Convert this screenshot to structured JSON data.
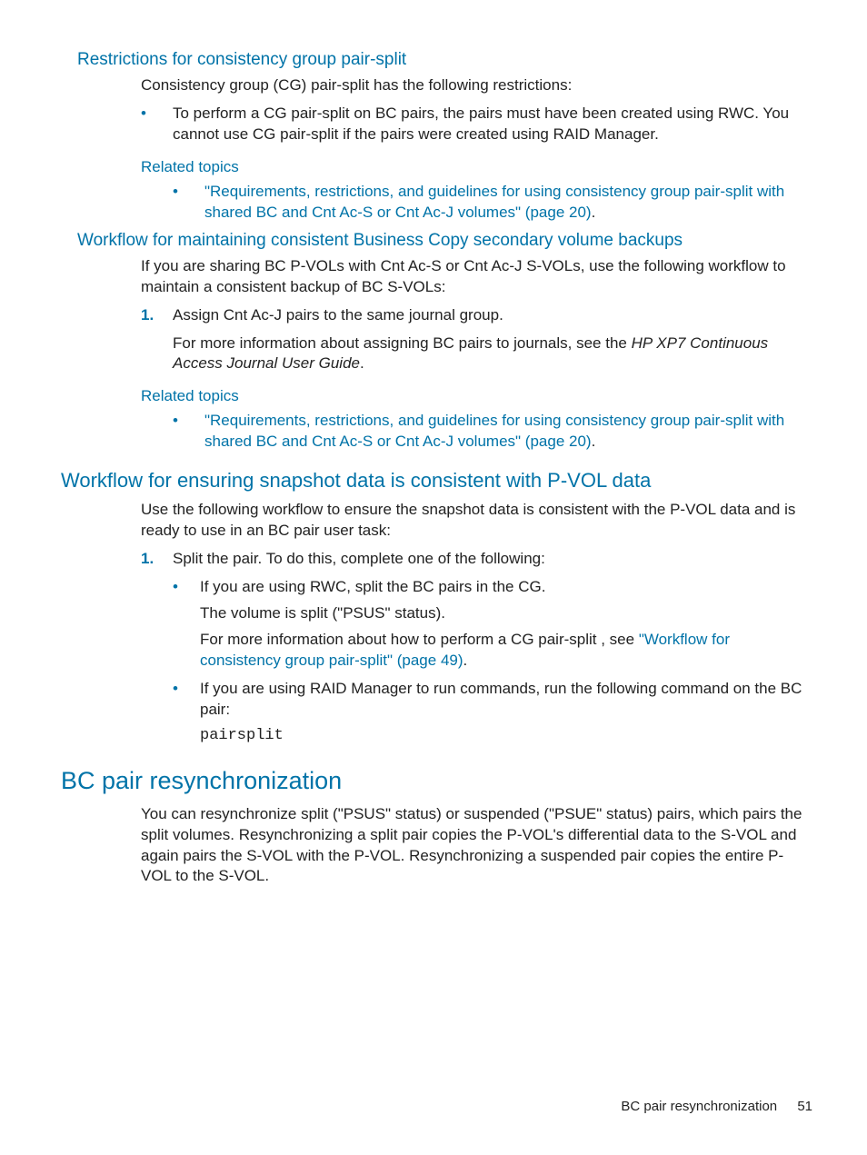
{
  "sec1": {
    "heading": "Restrictions for consistency group pair-split",
    "intro": "Consistency group (CG) pair-split has the following restrictions:",
    "bullet1": "To perform a CG pair-split on BC pairs, the pairs must have been created using RWC. You cannot use CG pair-split if the pairs were created using RAID Manager.",
    "related_heading": "Related topics",
    "related_link": "\"Requirements, restrictions, and guidelines for using consistency group pair-split with shared BC and Cnt Ac-S or Cnt Ac-J volumes\" (page 20)",
    "related_dot": "."
  },
  "sec2": {
    "heading": "Workflow for maintaining consistent Business Copy secondary volume backups",
    "intro": "If you are sharing BC P-VOLs with Cnt Ac-S or Cnt Ac-J S-VOLs, use the following workflow to maintain a consistent backup of BC S-VOLs:",
    "step1": "Assign Cnt Ac-J pairs to the same journal group.",
    "more_info_pre": "For more information about assigning BC pairs to journals, see the ",
    "more_info_italic": "HP XP7 Continuous Access Journal User Guide",
    "more_info_post": ".",
    "related_heading": "Related topics",
    "related_link": "\"Requirements, restrictions, and guidelines for using consistency group pair-split with shared BC and Cnt Ac-S or Cnt Ac-J volumes\" (page 20)",
    "related_dot": "."
  },
  "sec3": {
    "heading": "Workflow for ensuring snapshot data is consistent with P-VOL data",
    "intro": "Use the following workflow to ensure the snapshot data is consistent with the P-VOL data and is ready to use in an BC pair user task:",
    "step1": "Split the pair. To do this, complete one of the following:",
    "sub1_line1": "If you are using RWC, split the BC pairs in the CG.",
    "sub1_line2": "The volume is split (\"PSUS\" status).",
    "sub1_line3_pre": "For more information about how to perform a CG pair-split , see ",
    "sub1_line3_link": "\"Workflow for consistency group pair-split\" (page 49)",
    "sub1_line3_post": ".",
    "sub2_line1": "If you are using RAID Manager to run commands, run the following command on the BC pair:",
    "sub2_code": "pairsplit"
  },
  "sec4": {
    "heading": "BC pair resynchronization",
    "body": "You can resynchronize split (\"PSUS\" status) or suspended (\"PSUE\" status) pairs, which pairs the split volumes. Resynchronizing a split pair copies the P-VOL's differential data to the S-VOL and again pairs the S-VOL with the P-VOL. Resynchronizing a suspended pair copies the entire P-VOL to the S-VOL."
  },
  "footer": {
    "text": "BC pair resynchronization",
    "page": "51"
  }
}
